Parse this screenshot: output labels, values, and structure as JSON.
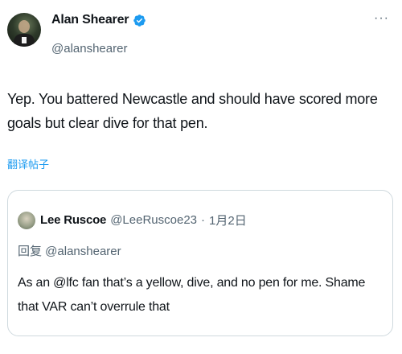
{
  "author": {
    "display_name": "Alan Shearer",
    "handle": "@alanshearer",
    "verified": true
  },
  "more_menu": "···",
  "tweet": {
    "text": "Yep. You battered Newcastle and should have scored more goals  but clear dive for that pen.",
    "translate_label": "翻译帖子"
  },
  "quoted_tweet": {
    "display_name": "Lee Ruscoe",
    "handle": "@LeeRuscoe23",
    "separator": "·",
    "date": "1月2日",
    "reply_to": "回复 @alanshearer",
    "text": "As an @lfc fan that’s a yellow, dive, and no pen for me. Shame that VAR can’t overrule that"
  },
  "colors": {
    "text": "#0f1419",
    "secondary": "#536471",
    "accent": "#1d9bf0",
    "border": "#cfd9de"
  },
  "icons": [
    "verified-badge-icon",
    "more-options-icon"
  ]
}
